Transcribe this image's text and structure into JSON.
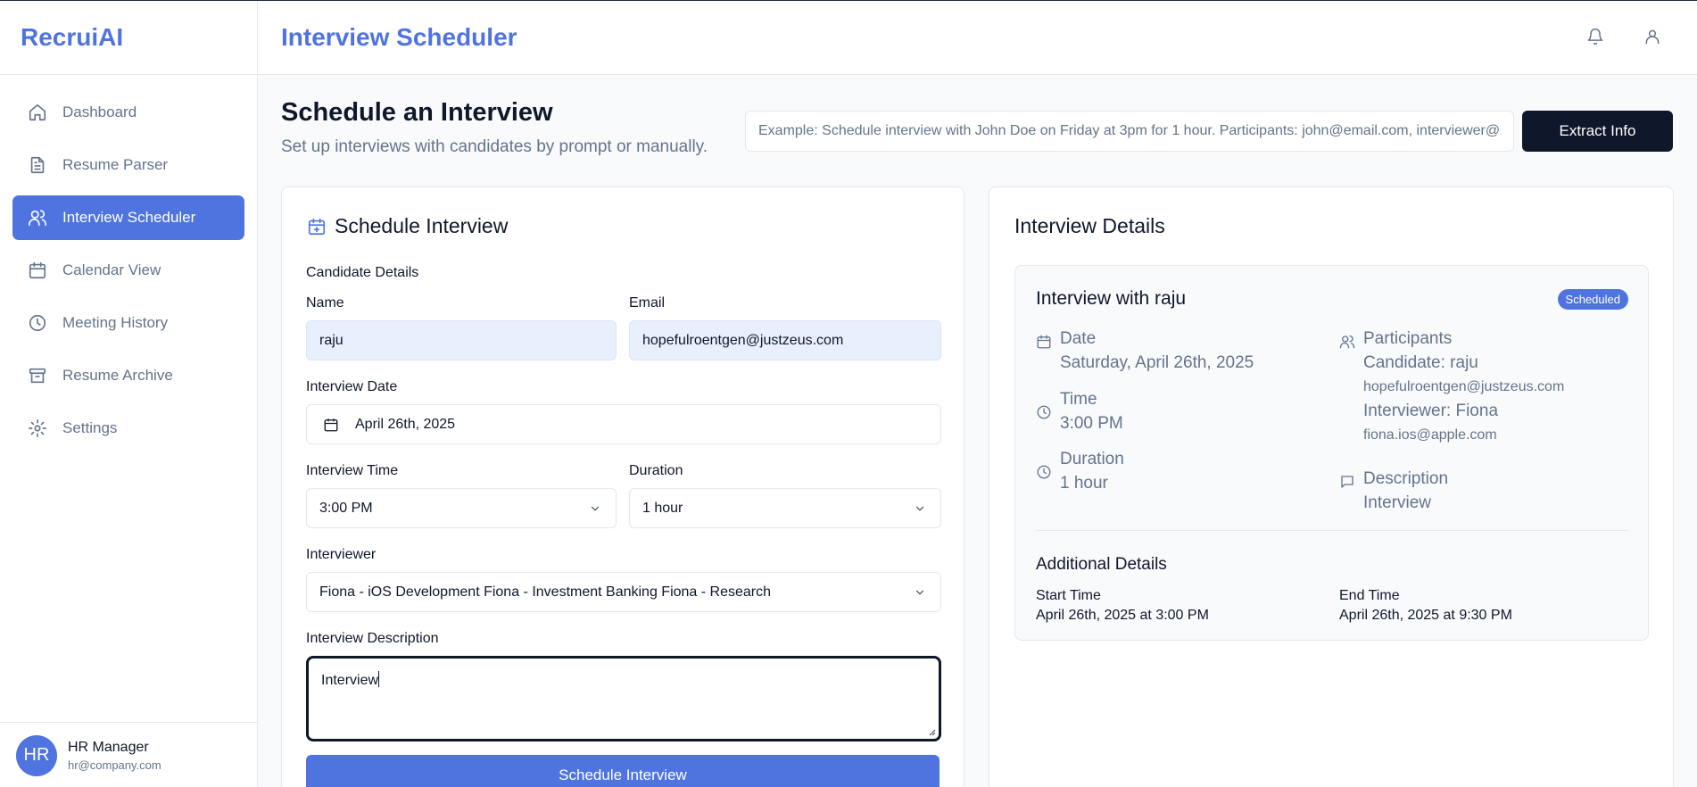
{
  "app": {
    "brand": "RecruiAI",
    "page_title": "Interview Scheduler"
  },
  "sidebar": {
    "items": [
      {
        "label": "Dashboard",
        "icon": "home-icon",
        "active": false
      },
      {
        "label": "Resume Parser",
        "icon": "file-text-icon",
        "active": false
      },
      {
        "label": "Interview Scheduler",
        "icon": "users-icon",
        "active": true
      },
      {
        "label": "Calendar View",
        "icon": "calendar-icon",
        "active": false
      },
      {
        "label": "Meeting History",
        "icon": "clock-icon",
        "active": false
      },
      {
        "label": "Resume Archive",
        "icon": "archive-icon",
        "active": false
      },
      {
        "label": "Settings",
        "icon": "gear-icon",
        "active": false
      }
    ],
    "user": {
      "initials": "HR",
      "name": "HR Manager",
      "email": "hr@company.com"
    }
  },
  "header": {
    "icons": [
      "bell-icon",
      "user-icon"
    ]
  },
  "main": {
    "title": "Schedule an Interview",
    "subtitle": "Set up interviews with candidates by prompt or manually.",
    "prompt_placeholder": "Example: Schedule interview with John Doe on Friday at 3pm for 1 hour. Participants: john@email.com, interviewer@company.com",
    "extract_label": "Extract Info"
  },
  "form": {
    "title": "Schedule Interview",
    "candidate_section": "Candidate Details",
    "name_label": "Name",
    "name_value": "raju",
    "email_label": "Email",
    "email_value": "hopefulroentgen@justzeus.com",
    "date_label": "Interview Date",
    "date_value": "April 26th, 2025",
    "time_label": "Interview Time",
    "time_value": "3:00 PM",
    "duration_label": "Duration",
    "duration_value": "1 hour",
    "interviewer_label": "Interviewer",
    "interviewer_value": "Fiona - iOS Development Fiona - Investment Banking Fiona - Research",
    "description_label": "Interview Description",
    "description_value": "Interview",
    "submit_label": "Schedule Interview"
  },
  "details": {
    "title": "Interview Details",
    "card_title": "Interview with raju",
    "status": "Scheduled",
    "date_label": "Date",
    "date_value": "Saturday, April 26th, 2025",
    "time_label": "Time",
    "time_value": "3:00 PM",
    "duration_label": "Duration",
    "duration_value": "1 hour",
    "participants_label": "Participants",
    "candidate_line": "Candidate: raju",
    "candidate_email": "hopefulroentgen@justzeus.com",
    "interviewer_line": "Interviewer: Fiona",
    "interviewer_email": "fiona.ios@apple.com",
    "description_label": "Description",
    "description_value": "Interview",
    "additional_title": "Additional Details",
    "start_label": "Start Time",
    "start_value": "April 26th, 2025 at 3:00 PM",
    "end_label": "End Time",
    "end_value": "April 26th, 2025 at 9:30 PM"
  },
  "colors": {
    "accent": "#4f74e0",
    "dark": "#0f172a",
    "muted": "#64748b",
    "field_filled": "#e8effd"
  }
}
